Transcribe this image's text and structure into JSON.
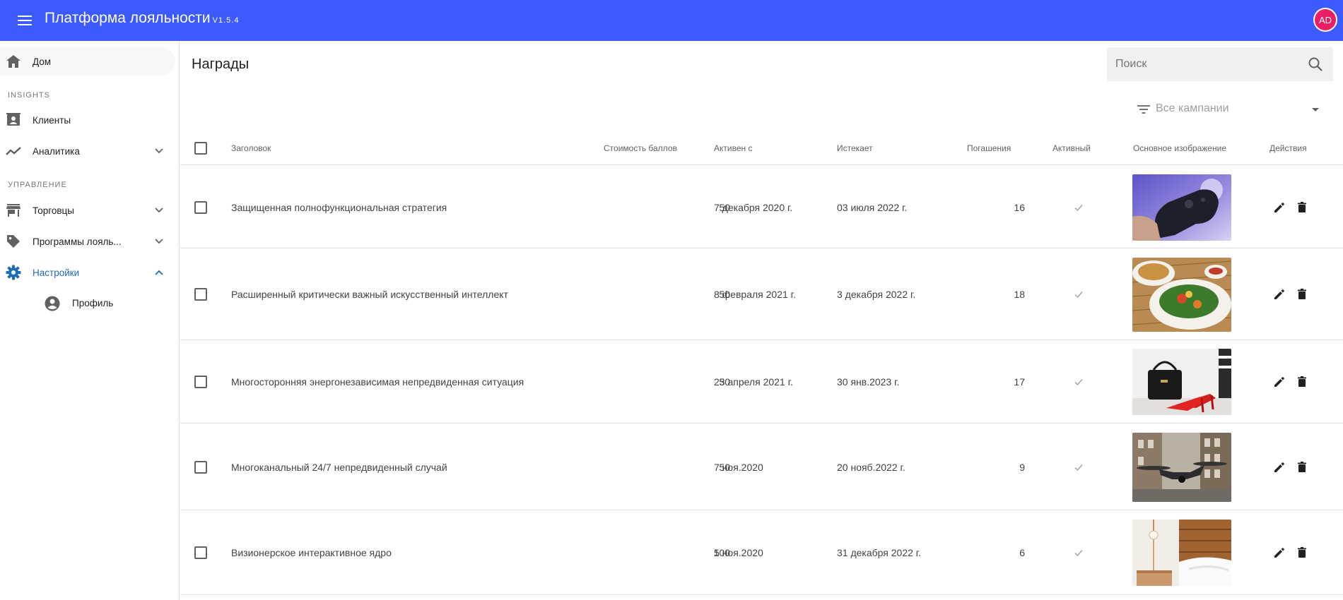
{
  "app": {
    "title": "Платформа лояльности",
    "version": "V1.5.4",
    "avatar_initials": "AD",
    "accent": "#3d5afe",
    "avatar_color": "#e91e63"
  },
  "sidebar": {
    "home": "Дом",
    "section_insights": "INSIGHTS",
    "clients": "Клиенты",
    "analytics": "Аналитика",
    "section_management": "УПРАВЛЕНИЕ",
    "merchants": "Торговцы",
    "programs": "Программы лояль...",
    "settings": "Настройки",
    "profile": "Профиль"
  },
  "page": {
    "title": "Награды",
    "search_placeholder": "Поиск",
    "filter_label": "Все кампании"
  },
  "table": {
    "headers": {
      "title": "Заголовок",
      "points": "Стоимость баллов",
      "active_from": "Активен с",
      "expires": "Истекает",
      "redemptions": "Погашения",
      "active": "Активный",
      "image": "Основное изображение",
      "actions": "Действия"
    },
    "rows": [
      {
        "title": "Защищенная полнофункциональная стратегия",
        "points": "50",
        "active_from": "7 декабря 2020 г.",
        "expires": "03 июля 2022 г.",
        "redemptions": "16",
        "active": true,
        "image": "game-controller"
      },
      {
        "title": "Расширенный критически важный искусственный интеллект",
        "points": "50",
        "active_from": "8 февраля 2021 г.",
        "expires": "3 декабря 2022 г.",
        "redemptions": "18",
        "active": true,
        "image": "food-plate"
      },
      {
        "title": "Многосторонняя энергонезависимая непредвиденная ситуация",
        "points": "50",
        "active_from": "23 апреля 2021 г.",
        "expires": "30 янв.2023 г.",
        "redemptions": "17",
        "active": true,
        "image": "red-shoes-handbag"
      },
      {
        "title": "Многоканальный 24/7 непредвиденный случай",
        "points": "50",
        "active_from": "7 ноя.2020",
        "expires": "20 нояб.2022 г.",
        "redemptions": "9",
        "active": true,
        "image": "drone"
      },
      {
        "title": "Визионерское интерактивное ядро",
        "points": "100",
        "active_from": "5 ноя.2020",
        "expires": "31 декабря 2022 г.",
        "redemptions": "6",
        "active": true,
        "image": "bedroom-lamp"
      }
    ]
  }
}
